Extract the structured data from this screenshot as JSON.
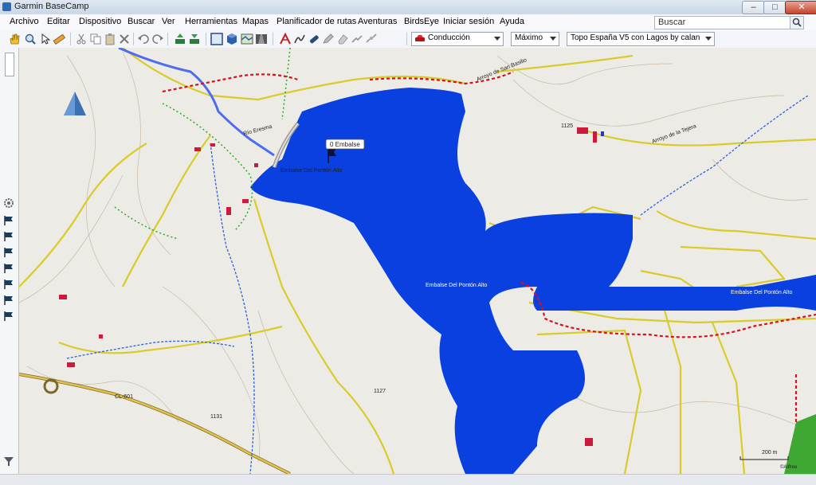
{
  "window": {
    "title": "Garmin BaseCamp",
    "minimize_icon": "minimize-icon",
    "maximize_icon": "maximize-icon",
    "close_icon": "close-icon"
  },
  "menu": {
    "items": [
      "Archivo",
      "Editar",
      "Dispositivo",
      "Buscar",
      "Ver",
      "Herramientas",
      "Mapas",
      "Planificador de rutas",
      "Aventuras",
      "BirdsEye",
      "Iniciar sesión",
      "Ayuda"
    ]
  },
  "search": {
    "placeholder": "Buscar"
  },
  "toolbar": {
    "profile": "Conducción",
    "detail": "Máximo",
    "map_product": "Topo España V5 con Lagos by calan",
    "icons": [
      "hand-icon",
      "zoom-icon",
      "select-icon",
      "measure-icon",
      "cut-icon",
      "copy-icon",
      "paste-icon",
      "delete-icon",
      "undo-icon",
      "redo-icon",
      "send-to-device-icon",
      "receive-from-device-icon",
      "2d-map-icon",
      "3d-map-icon",
      "map-view-icon",
      "road-view-icon",
      "new-route-icon",
      "new-track-icon",
      "waypoint-icon",
      "edit-icon",
      "eraser-icon",
      "join-icon",
      "split-icon"
    ]
  },
  "map": {
    "labels": {
      "waypoint": "0 Embalse",
      "reservoir_1": "Embalse Del Pontón Alto",
      "reservoir_2": "Embalse Del Pontón Alto",
      "reservoir_3": "Embalse Del Pontón Alto",
      "stream_1": "Arroyo de San Basilio",
      "stream_2": "Arroyo de la Tejera",
      "road_1": "CL-601",
      "river": "Río Eresma",
      "elev_1": "1125",
      "elev_2": "1127",
      "elev_3": "1131",
      "scale": "200 m",
      "credit": "©Allfree"
    },
    "colors": {
      "water": "#0a3fe0",
      "terrain": "#ecebe6",
      "road": "#d9cc2a",
      "boundary": "#d5121e",
      "trail": "#2aa92a"
    }
  }
}
